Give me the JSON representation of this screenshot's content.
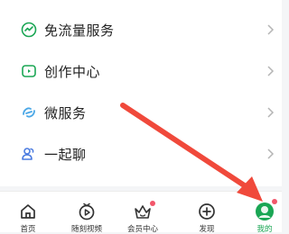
{
  "menu": {
    "items": [
      {
        "label": "免流量服务",
        "icon": "traffic-free-icon"
      },
      {
        "label": "创作中心",
        "icon": "creation-center-icon"
      },
      {
        "label": "微服务",
        "icon": "micro-service-icon"
      },
      {
        "label": "一起聊",
        "icon": "chat-together-icon"
      }
    ]
  },
  "tabbar": {
    "tabs": [
      {
        "label": "首页",
        "icon": "home-icon"
      },
      {
        "label": "随刻视频",
        "icon": "video-icon"
      },
      {
        "label": "会员中心",
        "icon": "vip-crown-icon",
        "badge": true
      },
      {
        "label": "发现",
        "icon": "discover-plus-icon"
      },
      {
        "label": "我的",
        "icon": "profile-avatar-icon",
        "active": true,
        "badge": true
      }
    ]
  },
  "colors": {
    "accent_green": "#1aa654",
    "badge_red": "#f2566a",
    "annotation_arrow": "#f0493b"
  }
}
